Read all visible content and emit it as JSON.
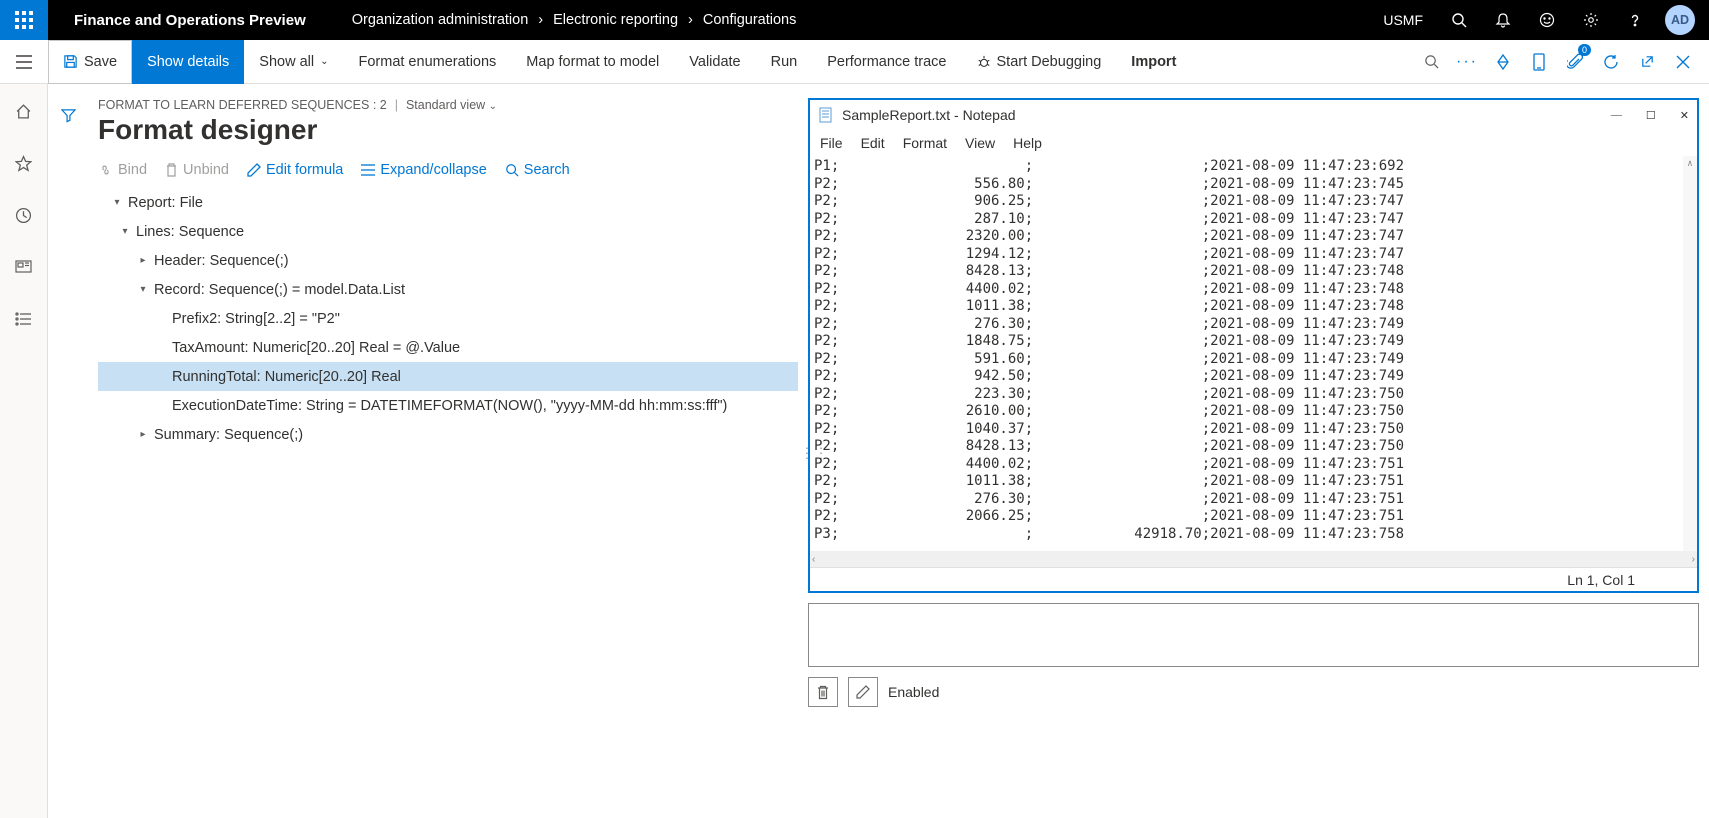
{
  "topbar": {
    "app_title": "Finance and Operations Preview",
    "breadcrumb": [
      "Organization administration",
      "Electronic reporting",
      "Configurations"
    ],
    "company": "USMF",
    "avatar": "AD"
  },
  "cmdbar": {
    "save": "Save",
    "show_details": "Show details",
    "show_all": "Show all",
    "format_enum": "Format enumerations",
    "map_format": "Map format to model",
    "validate": "Validate",
    "run": "Run",
    "perf_trace": "Performance trace",
    "start_debug": "Start Debugging",
    "import": "Import"
  },
  "page": {
    "sub": "FORMAT TO LEARN DEFERRED SEQUENCES : 2",
    "view": "Standard view",
    "title": "Format designer"
  },
  "toolbar2": {
    "bind": "Bind",
    "unbind": "Unbind",
    "edit_formula": "Edit formula",
    "expand": "Expand/collapse",
    "search": "Search"
  },
  "tree": {
    "n0": "Report: File",
    "n1": "Lines: Sequence",
    "n2": "Header: Sequence(;)",
    "n3": "Record: Sequence(;) = model.Data.List",
    "n4": "Prefix2: String[2..2] = \"P2\"",
    "n5": "TaxAmount: Numeric[20..20] Real = @.Value",
    "n6": "RunningTotal: Numeric[20..20] Real",
    "n7": "ExecutionDateTime: String = DATETIMEFORMAT(NOW(), \"yyyy-MM-dd hh:mm:ss:fff\")",
    "n8": "Summary: Sequence(;)"
  },
  "notepad": {
    "title": "SampleReport.txt - Notepad",
    "menu": [
      "File",
      "Edit",
      "Format",
      "View",
      "Help"
    ],
    "status_pos": "Ln 1, Col 1",
    "rows": [
      {
        "p": "P1",
        "v": "",
        "t": "2021-08-09 11:47:23:692"
      },
      {
        "p": "P2",
        "v": "556.80",
        "t": "2021-08-09 11:47:23:745"
      },
      {
        "p": "P2",
        "v": "906.25",
        "t": "2021-08-09 11:47:23:747"
      },
      {
        "p": "P2",
        "v": "287.10",
        "t": "2021-08-09 11:47:23:747"
      },
      {
        "p": "P2",
        "v": "2320.00",
        "t": "2021-08-09 11:47:23:747"
      },
      {
        "p": "P2",
        "v": "1294.12",
        "t": "2021-08-09 11:47:23:747"
      },
      {
        "p": "P2",
        "v": "8428.13",
        "t": "2021-08-09 11:47:23:748"
      },
      {
        "p": "P2",
        "v": "4400.02",
        "t": "2021-08-09 11:47:23:748"
      },
      {
        "p": "P2",
        "v": "1011.38",
        "t": "2021-08-09 11:47:23:748"
      },
      {
        "p": "P2",
        "v": "276.30",
        "t": "2021-08-09 11:47:23:749"
      },
      {
        "p": "P2",
        "v": "1848.75",
        "t": "2021-08-09 11:47:23:749"
      },
      {
        "p": "P2",
        "v": "591.60",
        "t": "2021-08-09 11:47:23:749"
      },
      {
        "p": "P2",
        "v": "942.50",
        "t": "2021-08-09 11:47:23:749"
      },
      {
        "p": "P2",
        "v": "223.30",
        "t": "2021-08-09 11:47:23:750"
      },
      {
        "p": "P2",
        "v": "2610.00",
        "t": "2021-08-09 11:47:23:750"
      },
      {
        "p": "P2",
        "v": "1040.37",
        "t": "2021-08-09 11:47:23:750"
      },
      {
        "p": "P2",
        "v": "8428.13",
        "t": "2021-08-09 11:47:23:750"
      },
      {
        "p": "P2",
        "v": "4400.02",
        "t": "2021-08-09 11:47:23:751"
      },
      {
        "p": "P2",
        "v": "1011.38",
        "t": "2021-08-09 11:47:23:751"
      },
      {
        "p": "P2",
        "v": "276.30",
        "t": "2021-08-09 11:47:23:751"
      },
      {
        "p": "P2",
        "v": "2066.25",
        "t": "2021-08-09 11:47:23:751"
      },
      {
        "p": "P3",
        "v": "",
        "sum": "42918.70",
        "t": "2021-08-09 11:47:23:758"
      }
    ]
  },
  "bottom": {
    "enabled": "Enabled"
  }
}
